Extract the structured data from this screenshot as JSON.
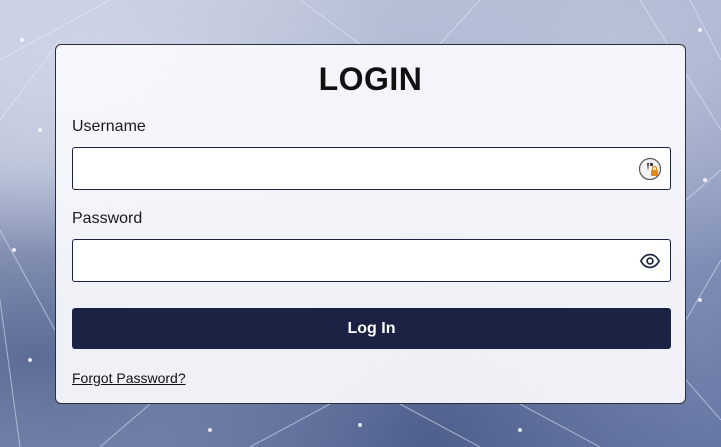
{
  "login": {
    "title": "LOGIN",
    "username_label": "Username",
    "username_value": "",
    "password_label": "Password",
    "password_value": "",
    "submit_label": "Log In",
    "forgot_label": "Forgot Password?"
  },
  "icons": {
    "username_field": "password-manager-icon",
    "password_field": "eye-icon"
  },
  "colors": {
    "button_bg": "#1b2244",
    "field_border": "#1c2340"
  }
}
